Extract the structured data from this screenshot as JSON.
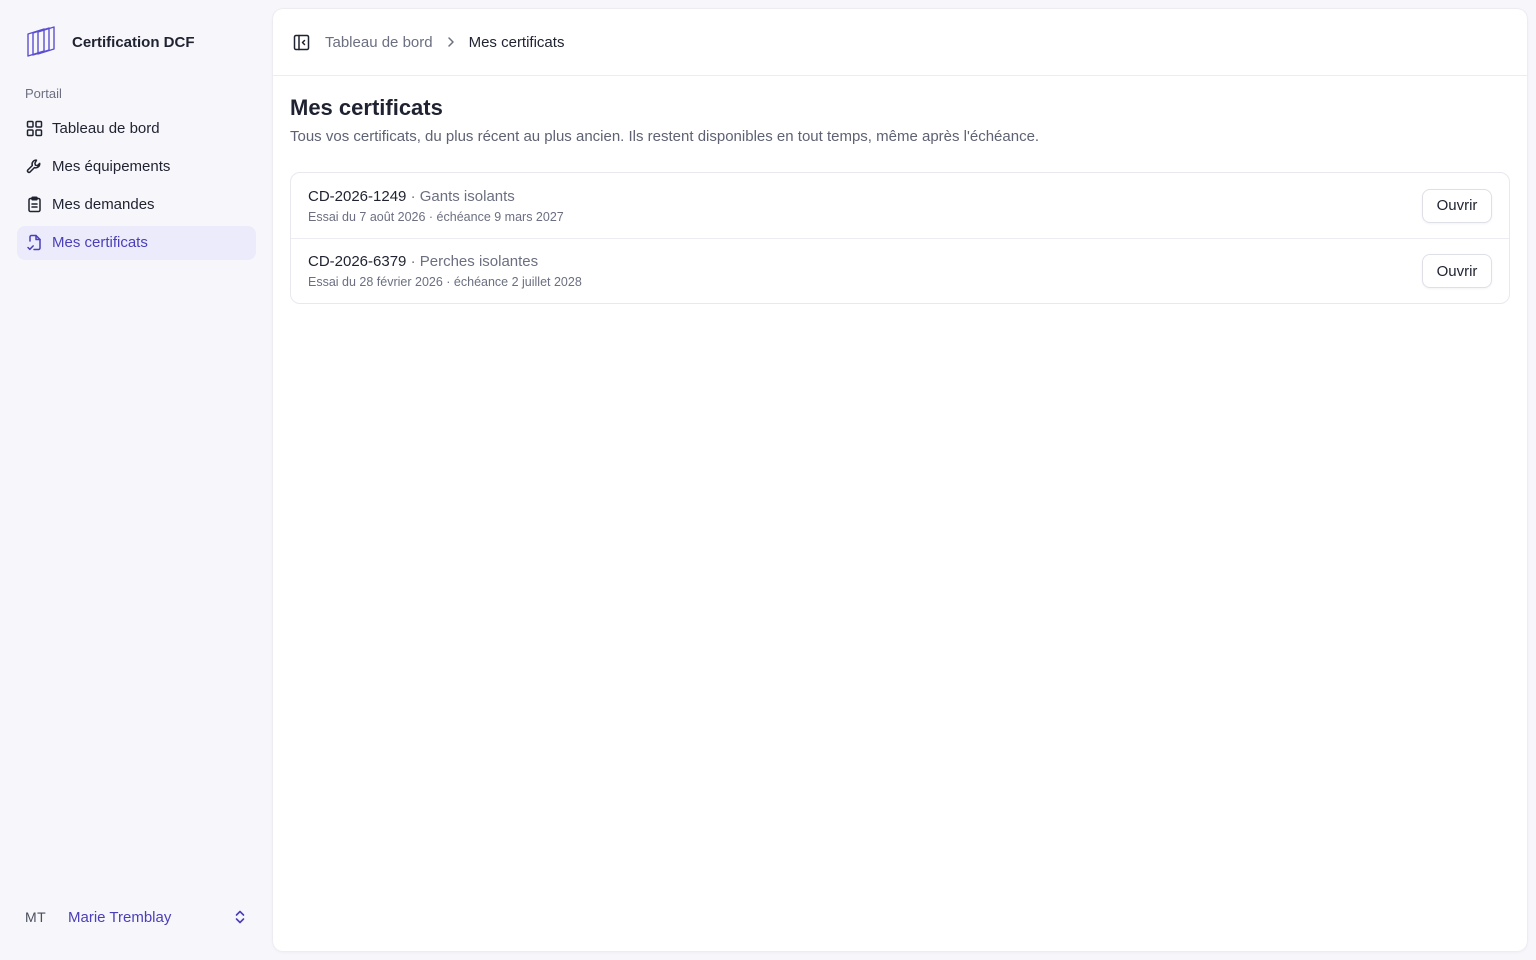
{
  "brand": {
    "name": "Certification DCF",
    "logo_icon": "layered-squares-logo",
    "accent": "#4a3fb8"
  },
  "sidebar": {
    "section_label": "Portail",
    "items": [
      {
        "label": "Tableau de bord",
        "icon": "grid-icon",
        "active": false
      },
      {
        "label": "Mes équipements",
        "icon": "wrench-icon",
        "active": false
      },
      {
        "label": "Mes demandes",
        "icon": "clipboard-icon",
        "active": false
      },
      {
        "label": "Mes certificats",
        "icon": "file-certificate-icon",
        "active": true
      }
    ],
    "user": {
      "initials": "MT",
      "name": "Marie Tremblay"
    }
  },
  "breadcrumb": {
    "parent": "Tableau de bord",
    "current": "Mes certificats"
  },
  "page": {
    "title": "Mes certificats",
    "subtitle": "Tous vos certificats, du plus récent au plus ancien. Ils restent disponibles en tout temps, même après l'échéance."
  },
  "certificates": [
    {
      "code": "CD-2026-1249",
      "separator": " · ",
      "type": "Gants isolants",
      "meta": "Essai du 7 août 2026 · échéance 9 mars 2027",
      "action": "Ouvrir"
    },
    {
      "code": "CD-2026-6379",
      "separator": " · ",
      "type": "Perches isolantes",
      "meta": "Essai du 28 février 2026 · échéance 2 juillet 2028",
      "action": "Ouvrir"
    }
  ]
}
